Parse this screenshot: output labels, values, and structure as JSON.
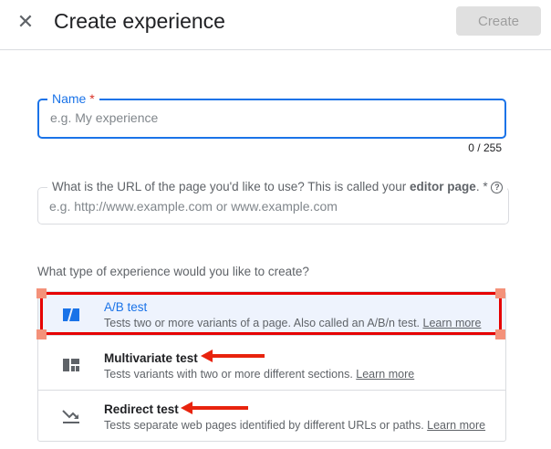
{
  "header": {
    "title": "Create experience",
    "create_label": "Create"
  },
  "name_field": {
    "label": "Name",
    "required": "*",
    "placeholder": "e.g. My experience",
    "counter": "0 / 255"
  },
  "url_field": {
    "label_prefix": "What is the URL of the page you'd like to use? This is called your ",
    "label_bold": "editor page",
    "label_suffix": ". *",
    "help": "?",
    "placeholder": "e.g. http://www.example.com or www.example.com"
  },
  "question": "What type of experience would you like to create?",
  "types": [
    {
      "title": "A/B test",
      "desc": "Tests two or more variants of a page. Also called an A/B/n test.",
      "link": "Learn more"
    },
    {
      "title": "Multivariate test",
      "desc": "Tests variants with two or more different sections.",
      "link": "Learn more"
    },
    {
      "title": "Redirect test",
      "desc": "Tests separate web pages identified by different URLs or paths.",
      "link": "Learn more"
    }
  ],
  "colors": {
    "accent": "#1a73e8",
    "annotation": "#e60000"
  }
}
